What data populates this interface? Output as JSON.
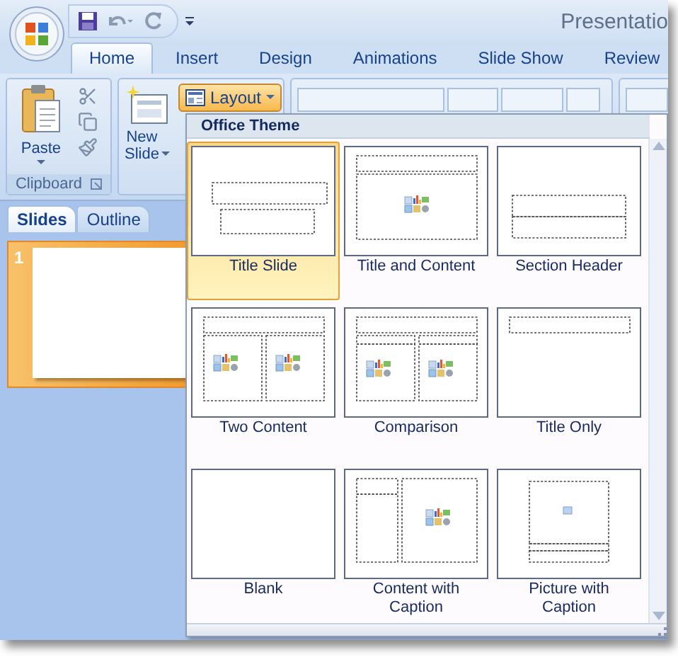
{
  "window": {
    "title": "Presentatio"
  },
  "ribbon_tabs": [
    {
      "label": "Home",
      "selected": true
    },
    {
      "label": "Insert",
      "selected": false
    },
    {
      "label": "Design",
      "selected": false
    },
    {
      "label": "Animations",
      "selected": false
    },
    {
      "label": "Slide Show",
      "selected": false
    },
    {
      "label": "Review",
      "selected": false
    }
  ],
  "clipboard": {
    "paste": "Paste",
    "group_label": "Clipboard"
  },
  "slides_group": {
    "new_slide": "New Slide",
    "layout": {
      "label": "Layout",
      "pressed": true
    }
  },
  "pane_tabs": [
    {
      "label": "Slides",
      "selected": true
    },
    {
      "label": "Outline",
      "selected": false
    }
  ],
  "slides": [
    {
      "number": "1",
      "selected": true
    }
  ],
  "layout_menu": {
    "heading": "Office Theme",
    "layouts": [
      {
        "kind": "title",
        "label": "Title Slide",
        "selected": true
      },
      {
        "kind": "title-content",
        "label": "Title and Content",
        "selected": false
      },
      {
        "kind": "section",
        "label": "Section Header",
        "selected": false
      },
      {
        "kind": "two-content",
        "label": "Two Content",
        "selected": false
      },
      {
        "kind": "comparison",
        "label": "Comparison",
        "selected": false
      },
      {
        "kind": "title-only",
        "label": "Title Only",
        "selected": false
      },
      {
        "kind": "blank",
        "label": "Blank",
        "selected": false
      },
      {
        "kind": "content-caption",
        "label": "Content with Caption",
        "selected": false
      },
      {
        "kind": "picture-caption",
        "label": "Picture with Caption",
        "selected": false
      }
    ]
  }
}
